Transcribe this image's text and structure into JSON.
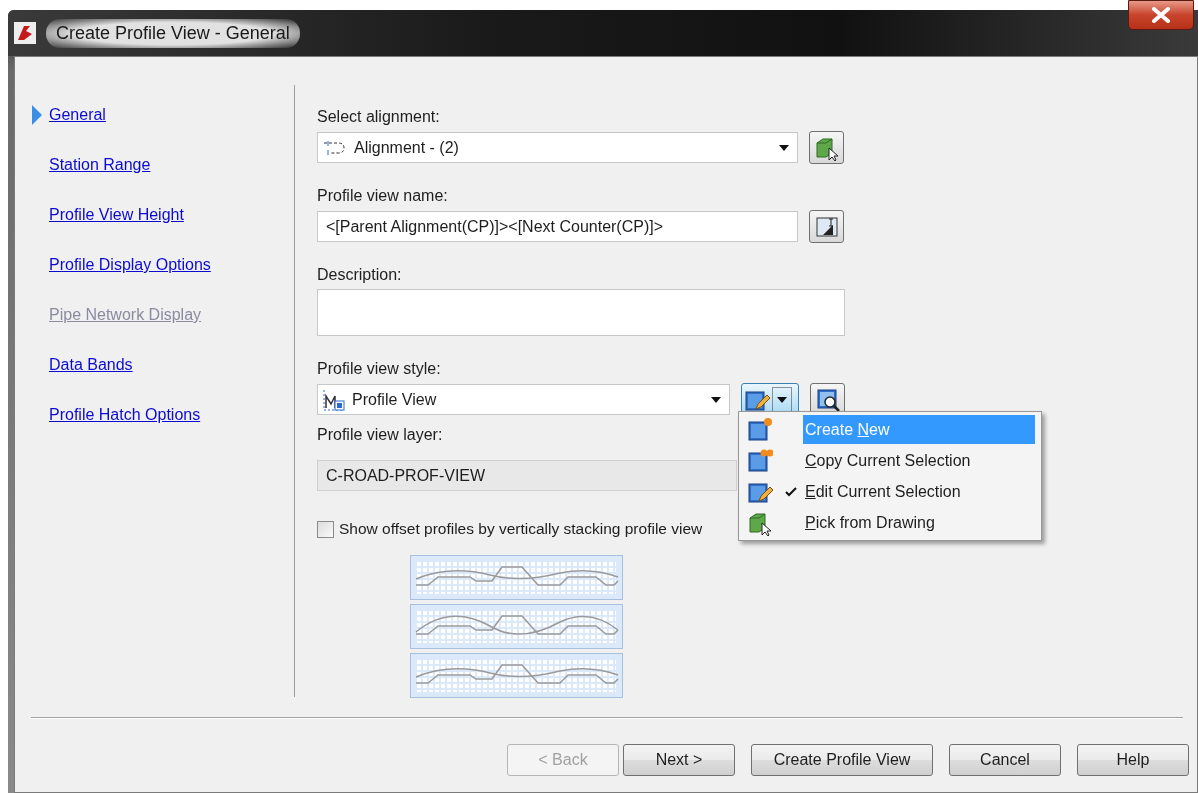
{
  "window": {
    "title": "Create Profile View - General"
  },
  "nav": [
    {
      "label": "General",
      "selected": true,
      "disabled": false
    },
    {
      "label": "Station Range",
      "selected": false,
      "disabled": false
    },
    {
      "label": "Profile View Height",
      "selected": false,
      "disabled": false
    },
    {
      "label": "Profile Display Options",
      "selected": false,
      "disabled": false
    },
    {
      "label": "Pipe Network Display",
      "selected": false,
      "disabled": true
    },
    {
      "label": "Data Bands",
      "selected": false,
      "disabled": false
    },
    {
      "label": "Profile Hatch Options",
      "selected": false,
      "disabled": false
    }
  ],
  "alignment": {
    "label": "Select alignment:",
    "value": "Alignment - (2)"
  },
  "profile_view_name": {
    "label": "Profile view name:",
    "value": "<[Parent Alignment(CP)]><[Next Counter(CP)]>"
  },
  "description": {
    "label": "Description:"
  },
  "profile_view_style": {
    "label": "Profile view style:",
    "value": "Profile View"
  },
  "profile_view_layer": {
    "label": "Profile view layer:",
    "value": "C-ROAD-PROF-VIEW"
  },
  "stack_option": {
    "label": "Show offset profiles by vertically stacking profile view",
    "checked": false
  },
  "style_menu": {
    "items": [
      {
        "kind": "create",
        "prefix": "Create ",
        "mnemonic": "N",
        "suffix": "ew",
        "selected": true,
        "checked": false
      },
      {
        "kind": "copy",
        "mnemonic": "C",
        "suffix": "opy Current Selection",
        "selected": false,
        "checked": false
      },
      {
        "kind": "edit",
        "mnemonic": "E",
        "suffix": "dit Current Selection",
        "selected": false,
        "checked": true
      },
      {
        "kind": "pick",
        "mnemonic": "P",
        "suffix": "ick from Drawing",
        "selected": false,
        "checked": false
      }
    ]
  },
  "buttons": [
    {
      "label": "< Back",
      "disabled": true
    },
    {
      "label": "Next >",
      "disabled": false
    },
    {
      "label": "Create Profile View",
      "disabled": false
    },
    {
      "label": "Cancel",
      "disabled": false
    },
    {
      "label": "Help",
      "disabled": false
    }
  ]
}
